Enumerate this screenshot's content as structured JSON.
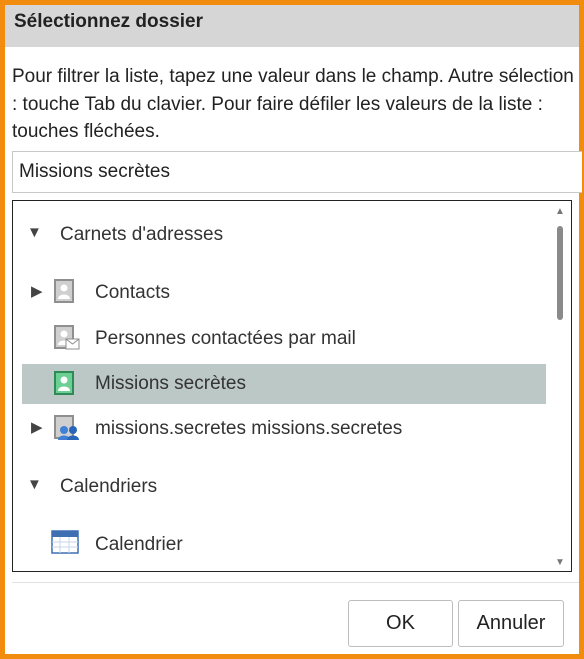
{
  "dialog": {
    "title": "Sélectionnez dossier",
    "instructions": "Pour filtrer la liste, tapez une valeur dans le champ. Autre sélection : touche Tab du clavier. Pour faire défiler les valeurs de la liste : touches fléchées.",
    "filter_value": "Missions secrètes"
  },
  "tree": {
    "group_address_books": "Carnets d'adresses",
    "contacts": "Contacts",
    "contacted_by_mail": "Personnes contactées par mail",
    "secret_missions": "Missions secrètes",
    "shared_book": "missions.secretes missions.secretes",
    "group_calendars": "Calendriers",
    "calendar": "Calendrier"
  },
  "icons": {
    "expanded": "triangle-down",
    "collapsed": "triangle-right",
    "contact_book": "contact-book-icon",
    "shared": "shared-users-icon",
    "calendar": "calendar-icon"
  },
  "buttons": {
    "ok": "OK",
    "cancel": "Annuler"
  },
  "colors": {
    "frame": "#f28c0f",
    "selection": "#bcc8c5",
    "titlebar": "#d6d6d6"
  }
}
